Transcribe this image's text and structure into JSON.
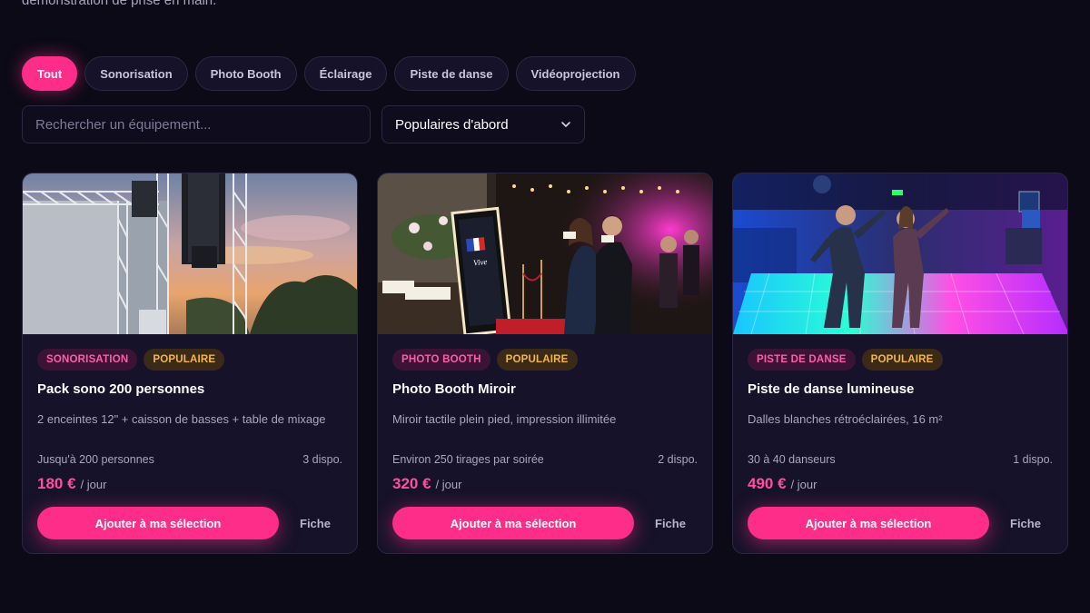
{
  "intro": {
    "text": "démonstration de prise en main."
  },
  "filters": [
    {
      "label": "Tout",
      "active": true
    },
    {
      "label": "Sonorisation"
    },
    {
      "label": "Photo Booth"
    },
    {
      "label": "Éclairage"
    },
    {
      "label": "Piste de danse"
    },
    {
      "label": "Vidéoprojection"
    }
  ],
  "search": {
    "placeholder": "Rechercher un équipement..."
  },
  "sort": {
    "selected": "Populaires d'abord",
    "icon": "chevron-down-icon"
  },
  "colors": {
    "accent": "#ff2d8a",
    "popular": "#f5b642",
    "background": "#0c0a17"
  },
  "products": [
    {
      "category": "SONORISATION",
      "badge": "POPULAIRE",
      "title": "Pack sono 200 personnes",
      "description": "2 enceintes 12\" + caisson de basses + table de mixage",
      "capacity": "Jusqu'à 200 personnes",
      "stock": "3 dispo.",
      "price": "180 €",
      "unit": "/ jour",
      "add_label": "Ajouter à ma sélection",
      "details_label": "Fiche"
    },
    {
      "category": "PHOTO BOOTH",
      "badge": "POPULAIRE",
      "title": "Photo Booth Miroir",
      "description": "Miroir tactile plein pied, impression illimitée",
      "capacity": "Environ 250 tirages par soirée",
      "stock": "2 dispo.",
      "price": "320 €",
      "unit": "/ jour",
      "add_label": "Ajouter à ma sélection",
      "details_label": "Fiche"
    },
    {
      "category": "PISTE DE DANSE",
      "badge": "POPULAIRE",
      "title": "Piste de danse lumineuse",
      "description": "Dalles blanches rétroéclairées, 16 m²",
      "capacity": "30 à 40 danseurs",
      "stock": "1 dispo.",
      "price": "490 €",
      "unit": "/ jour",
      "add_label": "Ajouter à ma sélection",
      "details_label": "Fiche"
    }
  ]
}
